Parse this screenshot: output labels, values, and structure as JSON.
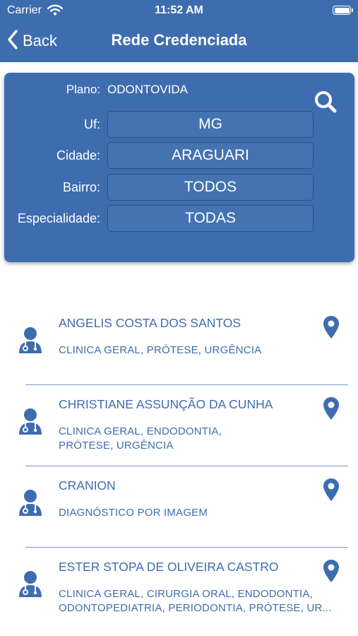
{
  "status_bar": {
    "carrier": "Carrier",
    "time": "11:52 AM"
  },
  "nav": {
    "back_label": "Back",
    "title": "Rede Credenciada"
  },
  "filters": {
    "plano_label": "Plano:",
    "plano_value": "ODONTOVIDA",
    "uf_label": "Uf:",
    "uf_value": "MG",
    "cidade_label": "Cidade:",
    "cidade_value": "ARAGUARI",
    "bairro_label": "Bairro:",
    "bairro_value": "TODOS",
    "especialidade_label": "Especialidade:",
    "especialidade_value": "TODAS"
  },
  "providers": [
    {
      "name": "ANGELIS COSTA DOS SANTOS",
      "specialties": [
        "CLINICA GERAL, PRÓTESE, URGÊNCIA"
      ]
    },
    {
      "name": "CHRISTIANE ASSUNÇÃO DA CUNHA",
      "specialties": [
        "CLINICA GERAL, ENDODONTIA,",
        "PRÓTESE, URGÊNCIA"
      ]
    },
    {
      "name": "CRANION",
      "specialties": [
        "DIAGNÓSTICO POR IMAGEM"
      ]
    },
    {
      "name": "ESTER STOPA DE OLIVEIRA CASTRO",
      "specialties": [
        "CLINICA GERAL, CIRURGIA ORAL, ENDODONTIA,",
        "ODONTOPEDIATRIA, PERIODONTIA, PRÓTESE, UR..."
      ]
    }
  ],
  "colors": {
    "primary": "#3e6daf",
    "background": "#ffffff"
  },
  "icons": {
    "back": "chevron-left-icon",
    "search": "search-icon",
    "provider": "doctor-icon",
    "location": "map-pin-icon"
  }
}
